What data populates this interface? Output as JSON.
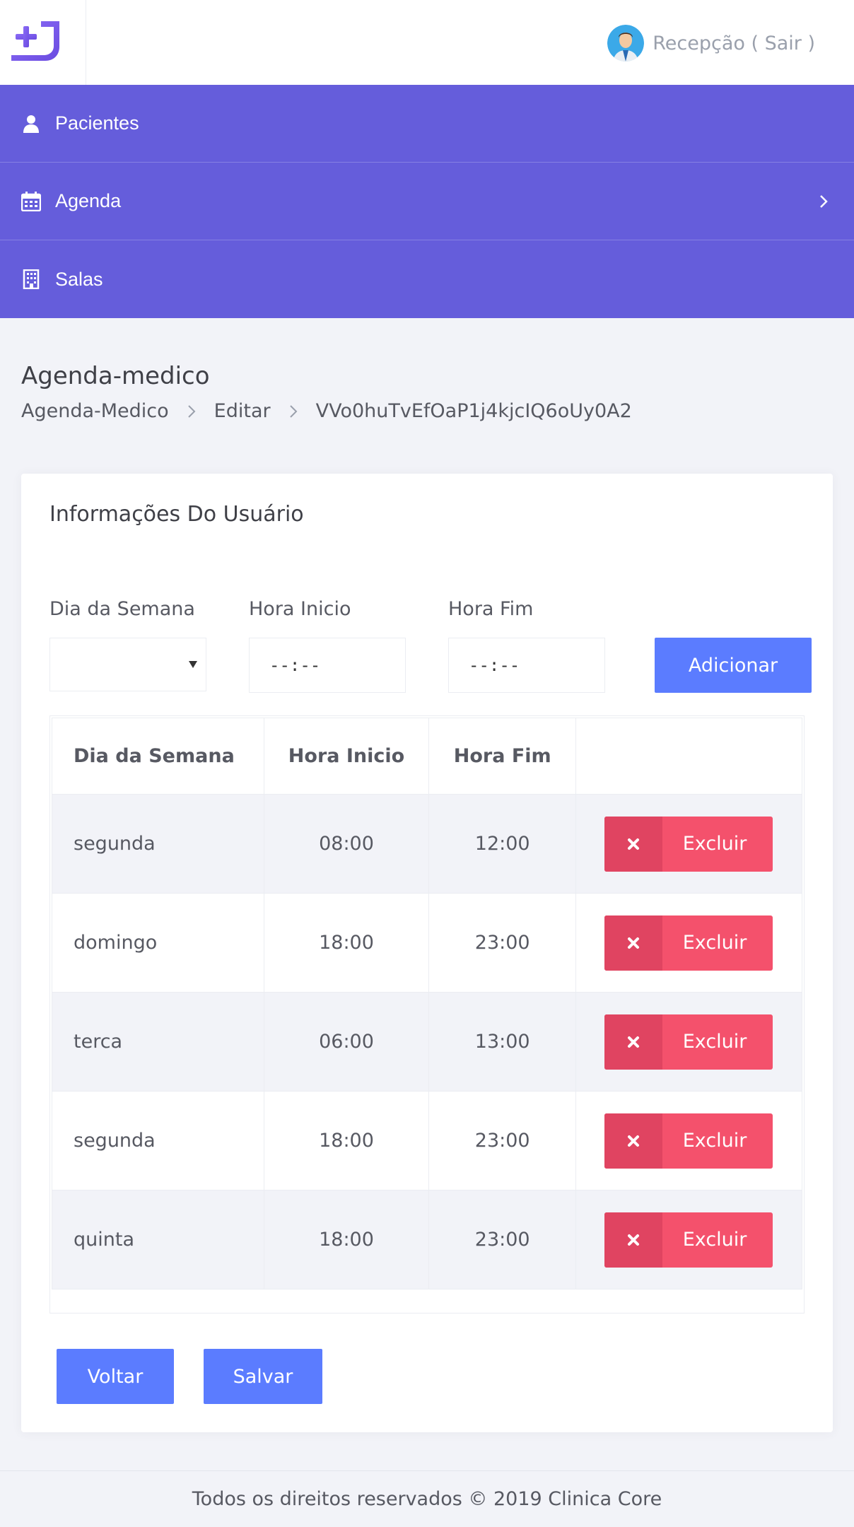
{
  "header": {
    "user_label": "Recepção ( Sair )"
  },
  "nav": {
    "items": [
      {
        "label": "Pacientes",
        "icon": "user-icon"
      },
      {
        "label": "Agenda",
        "icon": "calendar-icon",
        "has_submenu": true
      },
      {
        "label": "Salas",
        "icon": "building-icon"
      }
    ]
  },
  "page": {
    "title": "Agenda-medico",
    "breadcrumb": [
      "Agenda-Medico",
      "Editar",
      "VVo0huTvEfOaP1j4kjcIQ6oUy0A2"
    ]
  },
  "card": {
    "title": "Informações Do Usuário"
  },
  "form": {
    "day_label": "Dia da Semana",
    "day_value": "",
    "start_label": "Hora Inicio",
    "start_value": "--:--",
    "end_label": "Hora Fim",
    "end_value": "--:--",
    "add_button": "Adicionar"
  },
  "table": {
    "headers": [
      "Dia da Semana",
      "Hora Inicio",
      "Hora Fim",
      ""
    ],
    "delete_label": "Excluir",
    "rows": [
      {
        "day": "segunda",
        "start": "08:00",
        "end": "12:00"
      },
      {
        "day": "domingo",
        "start": "18:00",
        "end": "23:00"
      },
      {
        "day": "terca",
        "start": "06:00",
        "end": "13:00"
      },
      {
        "day": "segunda",
        "start": "18:00",
        "end": "23:00"
      },
      {
        "day": "quinta",
        "start": "18:00",
        "end": "23:00"
      }
    ]
  },
  "actions": {
    "back_label": "Voltar",
    "save_label": "Salvar"
  },
  "footer": {
    "text": "Todos os direitos reservados © 2019 Clinica Core"
  },
  "colors": {
    "nav_bg": "#655ddb",
    "primary": "#5b7cff",
    "danger": "#f4516c",
    "danger_dark": "#e04461",
    "logo": "#7b5cf0"
  }
}
